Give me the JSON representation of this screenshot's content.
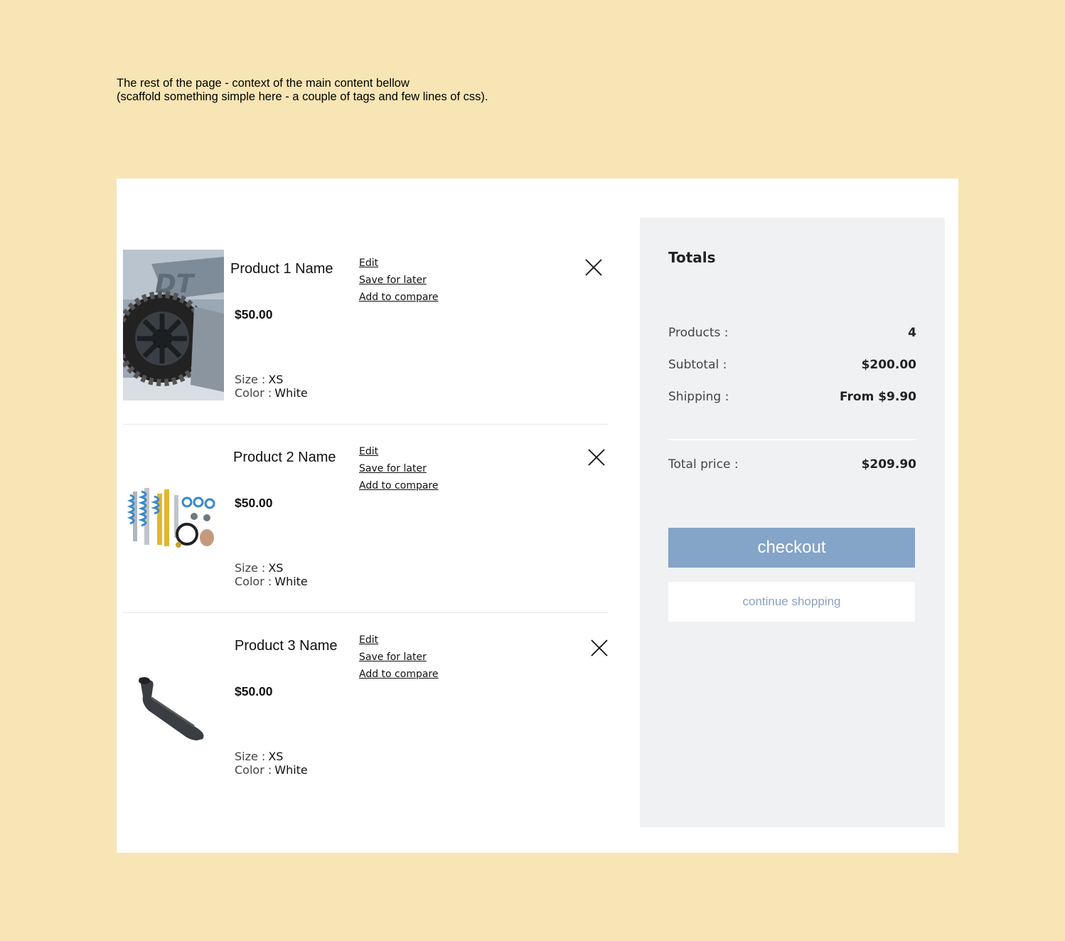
{
  "context_note": {
    "line1": "The rest of the page - context of the main content bellow",
    "line2": "(scaffold something simple here - a couple of tags and few lines of css)."
  },
  "cart": {
    "items": [
      {
        "name": "Product 1 Name",
        "price": "$50.00",
        "size_label": "Size :",
        "size_value": "XS",
        "color_label": "Color :",
        "color_value": "White",
        "image": "tire-photo",
        "actions": {
          "edit": "Edit",
          "save": "Save for later",
          "compare": "Add to compare"
        }
      },
      {
        "name": "Product 2 Name",
        "price": "$50.00",
        "size_label": "Size :",
        "size_value": "XS",
        "color_label": "Color :",
        "color_value": "White",
        "image": "suspension-kit-photo",
        "actions": {
          "edit": "Edit",
          "save": "Save for later",
          "compare": "Add to compare"
        }
      },
      {
        "name": "Product 3 Name",
        "price": "$50.00",
        "size_label": "Size :",
        "size_value": "XS",
        "color_label": "Color :",
        "color_value": "White",
        "image": "snorkel-photo",
        "actions": {
          "edit": "Edit",
          "save": "Save for later",
          "compare": "Add to compare"
        }
      }
    ]
  },
  "totals": {
    "title": "Totals",
    "products_label": "Products :",
    "products_value": "4",
    "subtotal_label": "Subtotal :",
    "subtotal_value": "$200.00",
    "shipping_label": "Shipping :",
    "shipping_value": "From $9.90",
    "total_label": "Total price :",
    "total_value": "$209.90",
    "checkout_label": "checkout",
    "continue_label": "continue shopping"
  },
  "colors": {
    "page_background": "#f8e5b5",
    "checkout_button": "#84a4c8",
    "continue_text": "#8aa2bd",
    "totals_background": "#f0f1f3"
  }
}
